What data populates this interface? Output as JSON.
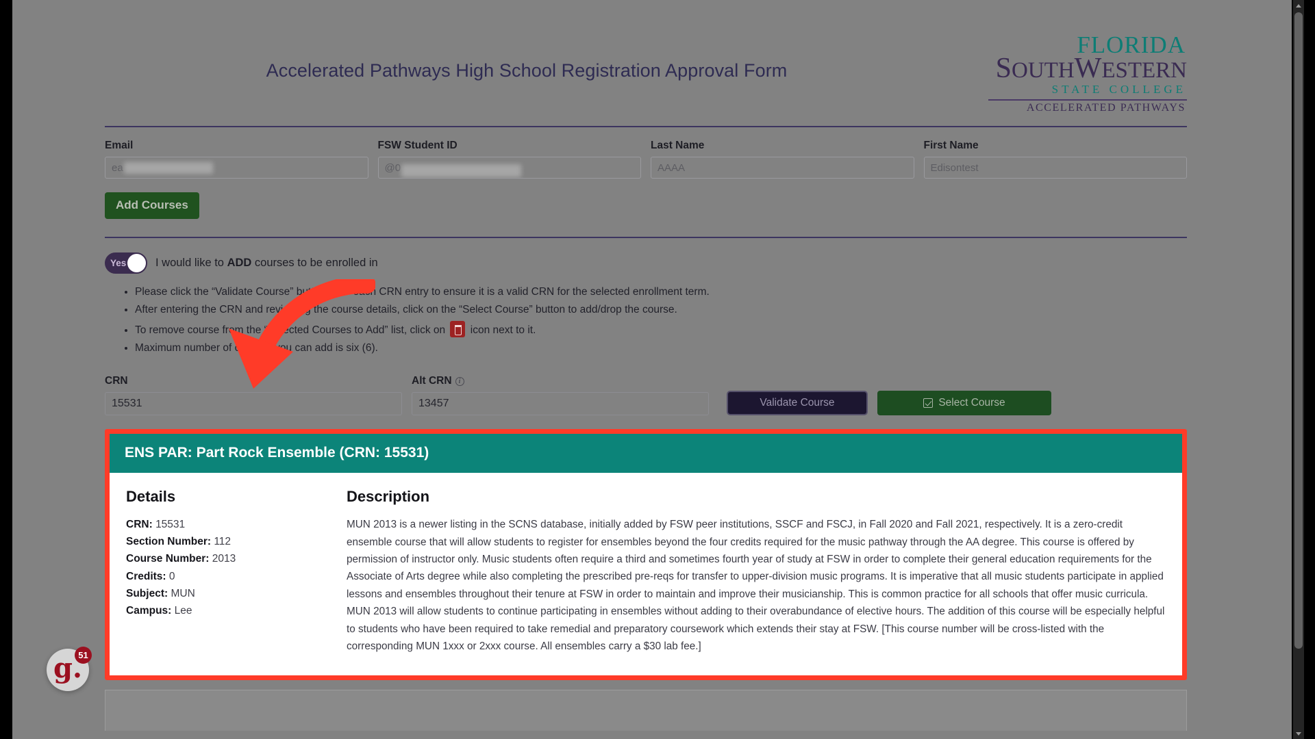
{
  "page": {
    "title": "Accelerated Pathways High School Registration Approval Form"
  },
  "logo": {
    "line1": "FLORIDA",
    "line2_a": "S",
    "line2_b": "OUTH",
    "line2_c": "W",
    "line2_d": "ESTERN",
    "line3": "STATE COLLEGE",
    "line4": "ACCELERATED PATHWAYS",
    "color_teal": "#0d7d75",
    "color_purple": "#3a2b52"
  },
  "fields": [
    {
      "label": "Email",
      "value": "ea",
      "redacted": true
    },
    {
      "label": "FSW Student ID",
      "value": "@0",
      "redacted": true
    },
    {
      "label": "Last Name",
      "value": "AAAA",
      "redacted": false
    },
    {
      "label": "First Name",
      "value": "Edisontest",
      "redacted": false
    }
  ],
  "toolbar": {
    "add_courses_label": "Add Courses"
  },
  "toggle": {
    "state_label": "Yes",
    "description_pre": "I would like to ",
    "description_strong": "ADD",
    "description_post": " courses to be enrolled in"
  },
  "notes": {
    "item1": "Please click the “Validate Course” button after each CRN entry to ensure it is a valid CRN for the selected enrollment term.",
    "item2": "After entering the CRN and reviewing the course details, click on the “Select Course” button to add/drop the course.",
    "item3_pre": "To remove course from the “Selected Courses to Add” list, click on ",
    "item3_post": " icon next to it.",
    "item4": "Maximum number of courses you can add is six (6)."
  },
  "crn_row": {
    "crn_label": "CRN",
    "crn_value": "15531",
    "alt_crn_label": "Alt CRN",
    "alt_crn_info": "i",
    "alt_crn_value": "13457",
    "validate_label": "Validate Course",
    "select_label": "Select Course"
  },
  "course_card": {
    "header": "ENS PAR: Part Rock Ensemble  (CRN: 15531)",
    "details_heading": "Details",
    "description_heading": "Description",
    "details": [
      {
        "label": "CRN:",
        "value": "15531"
      },
      {
        "label": "Section Number:",
        "value": "112"
      },
      {
        "label": "Course Number:",
        "value": "2013"
      },
      {
        "label": "Credits:",
        "value": "0"
      },
      {
        "label": "Subject:",
        "value": "MUN"
      },
      {
        "label": "Campus:",
        "value": "Lee"
      }
    ],
    "description": "MUN 2013 is a newer listing in the SCNS database, initially added by FSW peer institutions, SSCF and FSCJ, in Fall 2020 and Fall 2021, respectively. It is a zero-credit ensemble course that will allow students to register for ensembles beyond the four credits required for the music pathway through the AA degree. This course is offered by permission of instructor only. Music students often require a third and sometimes fourth year of study at FSW in order to complete their general education requirements for the Associate of Arts degree while also completing the prescribed pre-reqs for transfer to upper-division music programs. It is imperative that all music students participate in applied lessons and ensembles throughout their tenure at FSW in order to maintain and improve their musicianship. This is common practice for all schools that offer music curricula. MUN 2013 will allow students to continue participating in ensembles without adding to their overabundance of elective hours. The addition of this course will be especially helpful to students who have been required to take remedial and preparatory coursework which extends their stay at FSW. [This course number will be cross-listed with the corresponding MUN 1xxx or 2xxx course. All ensembles carry a $30 lab fee.]",
    "highlight_color": "#ff3b28",
    "header_color": "#0c8479"
  },
  "chat_badge": {
    "logo_text": "g.",
    "count": "51"
  },
  "colors": {
    "page_overlay": "#828282",
    "title_text": "#2e2b52",
    "green_button": "#20521f",
    "dark_button": "#1c1630"
  }
}
